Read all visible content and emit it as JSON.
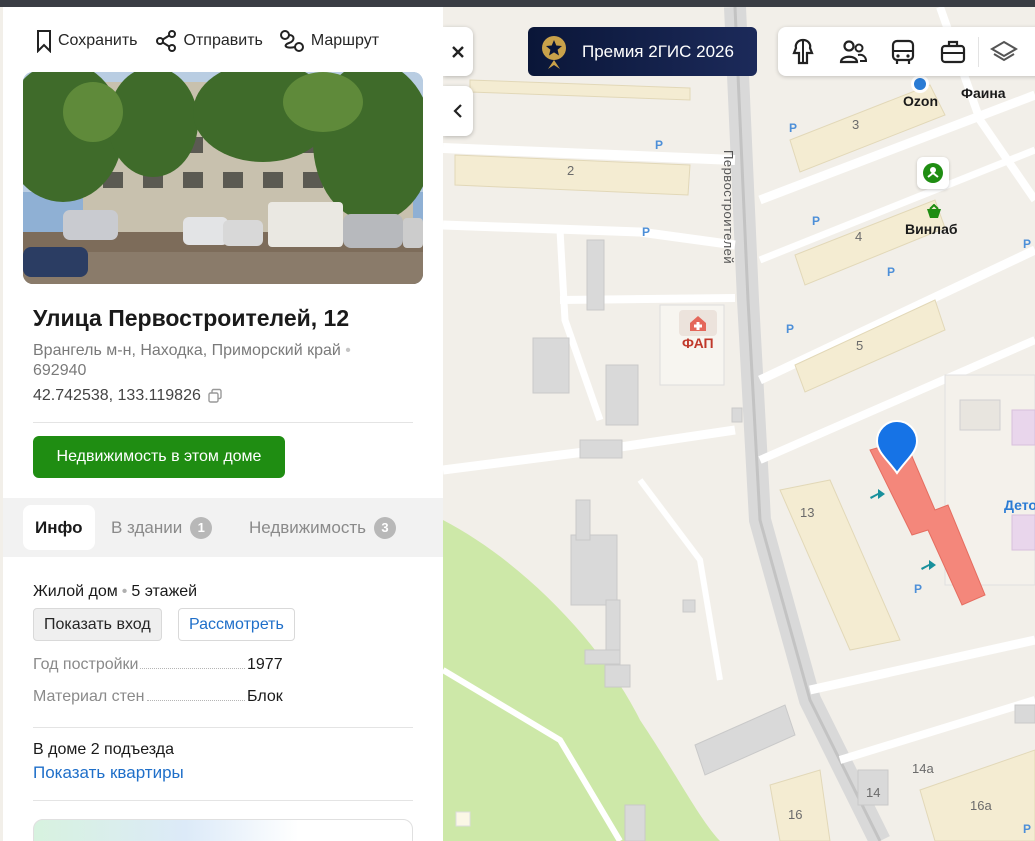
{
  "actions": {
    "save_label": "Сохранить",
    "share_label": "Отправить",
    "route_label": "Маршрут"
  },
  "place": {
    "title": "Улица Первостроителей, 12",
    "address": "Врангель м-н, Находка, Приморский край",
    "postcode": "692940",
    "coordinates": "42.742538, 133.119826",
    "realty_button": "Недвижимость в этом доме"
  },
  "tabs": [
    {
      "label": "Инфо",
      "active": true
    },
    {
      "label": "В здании",
      "count": "1"
    },
    {
      "label": "Недвижимость",
      "count": "3"
    }
  ],
  "info": {
    "type": "Жилой дом",
    "floors": "5 этажей",
    "show_entrance": "Показать вход",
    "inspect": "Рассмотреть",
    "year_key": "Год постройки",
    "year_value": "1977",
    "material_key": "Материал стен",
    "material_value": "Блок",
    "entrances": "В доме 2 подъезда",
    "show_apartments": "Показать квартиры"
  },
  "map": {
    "award_label": "Премия 2ГИС 2026",
    "street": "Первостроителей",
    "building_numbers": [
      "2",
      "3",
      "4",
      "5",
      "13",
      "14",
      "14а",
      "16",
      "16а"
    ],
    "pois": [
      {
        "name": "Ozon",
        "color": "#2a7bd4"
      },
      {
        "name": "Фаина",
        "color": "#1f8d12"
      },
      {
        "name": "Винлаб",
        "color": "#1f8d12"
      },
      {
        "name": "ФАП",
        "color": "#c0392b"
      },
      {
        "name": "Дето",
        "color": "#2a7bd4"
      }
    ],
    "parking_symbol": "P",
    "toolbar_icons": [
      "attractions-icon",
      "people-icon",
      "bus-icon",
      "briefcase-icon",
      "layers-icon"
    ]
  },
  "colors": {
    "accent_green": "#1f8d12",
    "link_blue": "#1f6fc9",
    "selected_building": "#f4877b",
    "pin_blue": "#1673e6"
  }
}
